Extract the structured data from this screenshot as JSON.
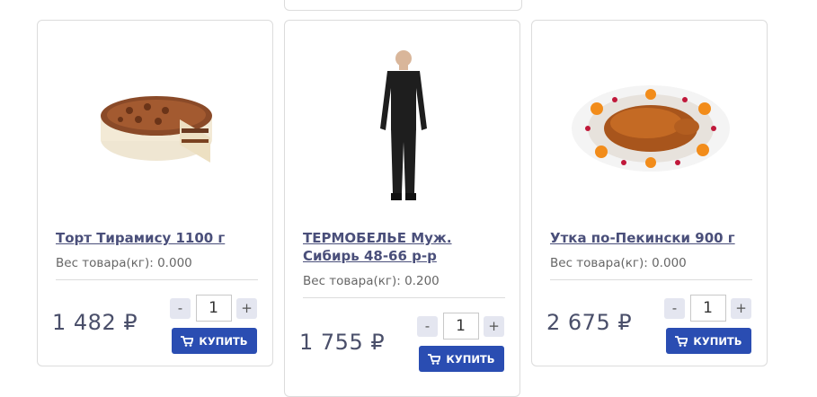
{
  "currency_symbol": "₽",
  "buy_label": "КУПИТЬ",
  "products": [
    {
      "title": "Торт Тирамису 1100 г",
      "weight_text": "Вес товара(кг): 0.000",
      "price": "1 482 ₽",
      "quantity": "1",
      "minus": "-",
      "plus": "+",
      "image": "tiramisu-cake-image"
    },
    {
      "title": "ТЕРМОБЕЛЬЕ Муж. Сибирь 48-66 р-р",
      "weight_text": "Вес товара(кг): 0.200",
      "price": "1 755 ₽",
      "quantity": "1",
      "minus": "-",
      "plus": "+",
      "image": "thermal-underwear-image"
    },
    {
      "title": "Утка по-Пекински 900 г",
      "weight_text": "Вес товара(кг): 0.000",
      "price": "2 675 ₽",
      "quantity": "1",
      "minus": "-",
      "plus": "+",
      "image": "peking-duck-image"
    }
  ],
  "colors": {
    "title": "#4a4f7a",
    "buy_button": "#2a4db2",
    "qty_button": "#e4e6f0"
  }
}
